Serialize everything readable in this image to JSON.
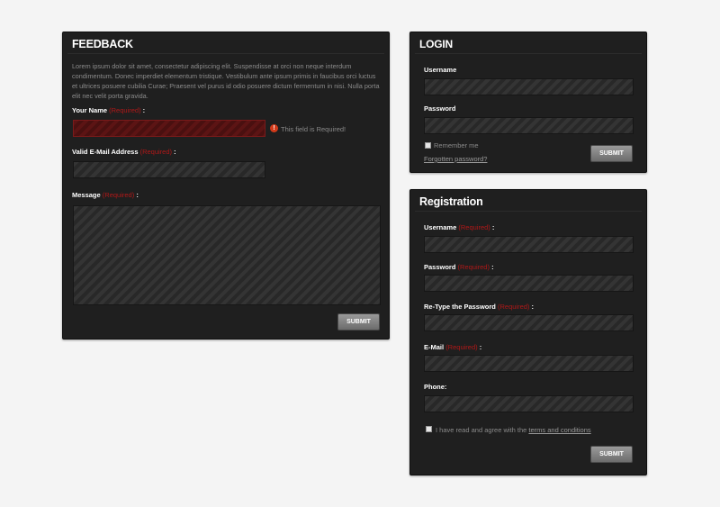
{
  "feedback": {
    "title": "FEEDBACK",
    "description": "Lorem ipsum dolor sit amet, consectetur adipiscing elit. Suspendisse at orci non neque interdum condimentum. Donec imperdiet elementum tristique. Vestibulum ante ipsum primis in faucibus orci luctus et ultrices posuere cubilia Curae; Praesent vel purus id odio posuere dictum fermentum in nisi. Nulla porta elit nec velit porta gravida.",
    "name_label": "Your Name",
    "email_label": "Valid E-Mail Address",
    "message_label": "Message",
    "required_text": "(Required)",
    "colon": ":",
    "error_text": "This field is Required!",
    "submit": "SUBMIT"
  },
  "login": {
    "title": "LOGIN",
    "username_label": "Username",
    "password_label": "Password",
    "remember_label": "Remember me",
    "forgot_link": "Forgotten password?",
    "submit": "SUBMIT"
  },
  "registration": {
    "title": "Registration",
    "username_label": "Username",
    "password_label": "Password",
    "retype_label": "Re-Type the Password",
    "email_label": "E-Mail",
    "phone_label": "Phone:",
    "required_text": "(Required)",
    "colon": ":",
    "agree_text": "I have read and agree with the",
    "terms_link": "terms and conditions",
    "submit": "SUBMIT"
  },
  "colors": {
    "panel_bg": "#1f1f1f",
    "required": "#b11818",
    "error_field": "#4a1010",
    "page_bg": "#f4f4f4"
  }
}
